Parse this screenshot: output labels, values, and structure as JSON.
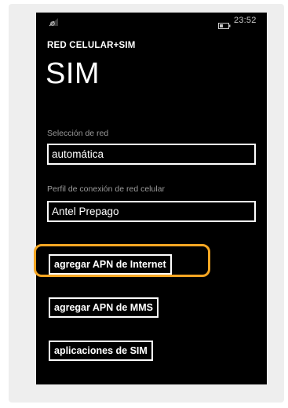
{
  "status_bar": {
    "signal_icon": "signal-icon",
    "battery_icon": "battery-icon",
    "time": "23:52"
  },
  "header": {
    "app_title": "RED CELULAR+SIM",
    "page_title": "SIM"
  },
  "network_selection": {
    "label": "Selección de red",
    "value": "automática"
  },
  "connection_profile": {
    "label": "Perfil de conexión de red celular",
    "value": "Antel Prepago"
  },
  "buttons": {
    "add_internet_apn": "agregar APN de Internet",
    "add_mms_apn": "agregar APN de MMS",
    "sim_apps": "aplicaciones de SIM"
  },
  "colors": {
    "screen_background": "#000000",
    "highlight": "#f5a623",
    "label_gray": "#9a9a9a"
  }
}
